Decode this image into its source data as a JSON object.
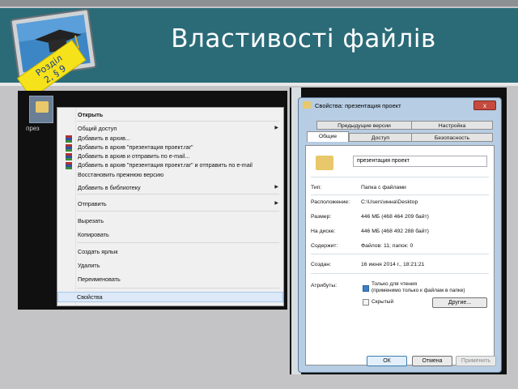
{
  "slide": {
    "title": "Властивості файлів",
    "badge_line1": "Розділ",
    "badge_line2": "2, § 9"
  },
  "desktop": {
    "icon_label": "през"
  },
  "context_menu": {
    "items": [
      {
        "label": "Открыть",
        "bold": true
      },
      {
        "label": "Общий доступ",
        "submenu": true
      },
      {
        "label": "Добавить в архив...",
        "icon": "winrar-icon"
      },
      {
        "label": "Добавить в архив \"презентация проект.rar\"",
        "icon": "winrar-icon"
      },
      {
        "label": "Добавить в архив и отправить по e-mail...",
        "icon": "winrar-icon"
      },
      {
        "label": "Добавить в архив \"презентация проект.rar\" и отправить по e-mail",
        "icon": "winrar-icon"
      },
      {
        "label": "Восстановить прежнюю версию"
      },
      {
        "label": "Добавить в библиотеку",
        "submenu": true
      },
      {
        "label": "Отправить",
        "submenu": true
      },
      {
        "label": "Вырезать"
      },
      {
        "label": "Копировать"
      },
      {
        "label": "Создать ярлык"
      },
      {
        "label": "Удалить"
      },
      {
        "label": "Переименовать"
      },
      {
        "label": "Свойства",
        "selected": true
      }
    ]
  },
  "properties_dialog": {
    "title": "Свойства: презентация проект",
    "close_label": "x",
    "tabs_row1": [
      "Предыдущие версии",
      "Настройка"
    ],
    "tabs_row2": [
      "Общие",
      "Доступ",
      "Безопасность"
    ],
    "active_tab": "Общие",
    "folder_name": "презентация проект",
    "properties": [
      {
        "label": "Тип:",
        "value": "Папка с файлами"
      },
      {
        "label": "Расположение:",
        "value": "C:\\Users\\инна\\Desktop"
      },
      {
        "label": "Размер:",
        "value": "446 МБ (468 464 209 байт)"
      },
      {
        "label": "На диске:",
        "value": "446 МБ (468 492 288 байт)"
      },
      {
        "label": "Содержит:",
        "value": "Файлов: 11; папок: 0"
      },
      {
        "label": "Создан:",
        "value": "16 июня 2014 г., 18:21:21"
      }
    ],
    "attributes_label": "Атрибуты:",
    "readonly_line1": "Только для чтения",
    "readonly_line2": "(применимо только к файлам в папке)",
    "hidden_label": "Скрытый",
    "other_button": "Другие...",
    "ok_button": "ОК",
    "cancel_button": "Отмена",
    "apply_button": "Применить"
  },
  "colors": {
    "header": "#2b6b78",
    "background": "#c4c4c6",
    "badge": "#f5e21a"
  }
}
